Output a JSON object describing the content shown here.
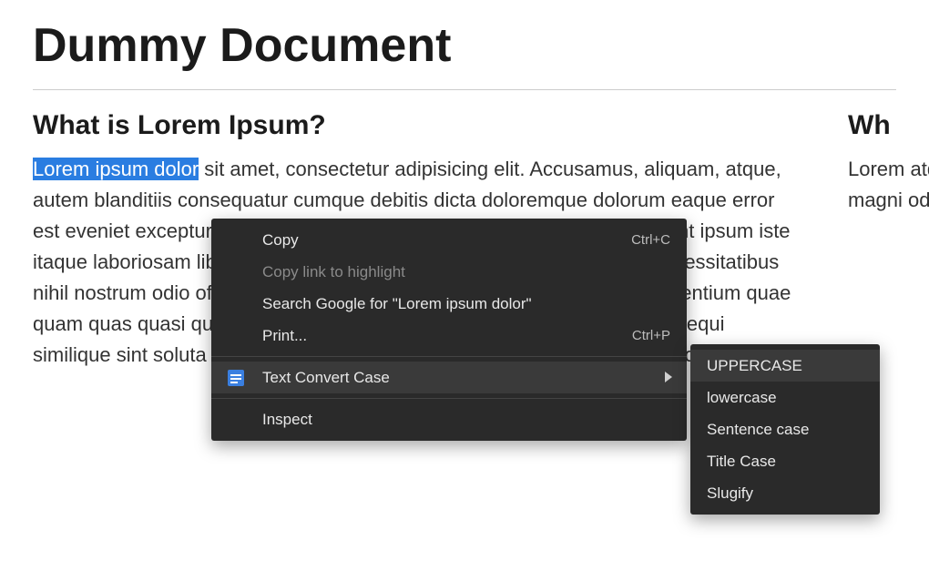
{
  "document": {
    "title": "Dummy Document",
    "heading_left": "What is Lorem Ipsum?",
    "heading_right": "Wh",
    "selected_text": "Lorem ipsum dolor",
    "para_after_selection": " sit amet, consectetur adipisicing elit. Accusamus, aliquam, atque, autem blanditiis consequatur cumque debitis dicta doloremque dolorum eaque error est eveniet excepturi explicabo fugiat fugit harum hic id illo impedit incidunt ipsum iste itaque laboriosam libero magni maxime minima modi molestiae natus necessitatibus nihil nostrum odio officia omnis perspiciatis placeat porro possimus praesentium quae quam quas quasi qui quibusdam quisquam ratione repellat sapiente sed sequi similique sint soluta suscipit temporibus totam unde vel vero voluptatem voluptates.",
    "para_right": "Lorem atque dolor harum magni odio"
  },
  "context_menu": {
    "items": [
      {
        "label": "Copy",
        "shortcut": "Ctrl+C",
        "disabled": false
      },
      {
        "label": "Copy link to highlight",
        "shortcut": "",
        "disabled": true
      },
      {
        "label": "Search Google for \"Lorem ipsum dolor\"",
        "shortcut": "",
        "disabled": false
      },
      {
        "label": "Print...",
        "shortcut": "Ctrl+P",
        "disabled": false
      }
    ],
    "extension": {
      "label": "Text Convert Case",
      "icon": "text-convert-icon"
    },
    "inspect_label": "Inspect"
  },
  "submenu": {
    "items": [
      {
        "label": "UPPERCASE",
        "hover": true
      },
      {
        "label": "lowercase",
        "hover": false
      },
      {
        "label": "Sentence case",
        "hover": false
      },
      {
        "label": "Title Case",
        "hover": false
      },
      {
        "label": "Slugify",
        "hover": false
      }
    ]
  }
}
